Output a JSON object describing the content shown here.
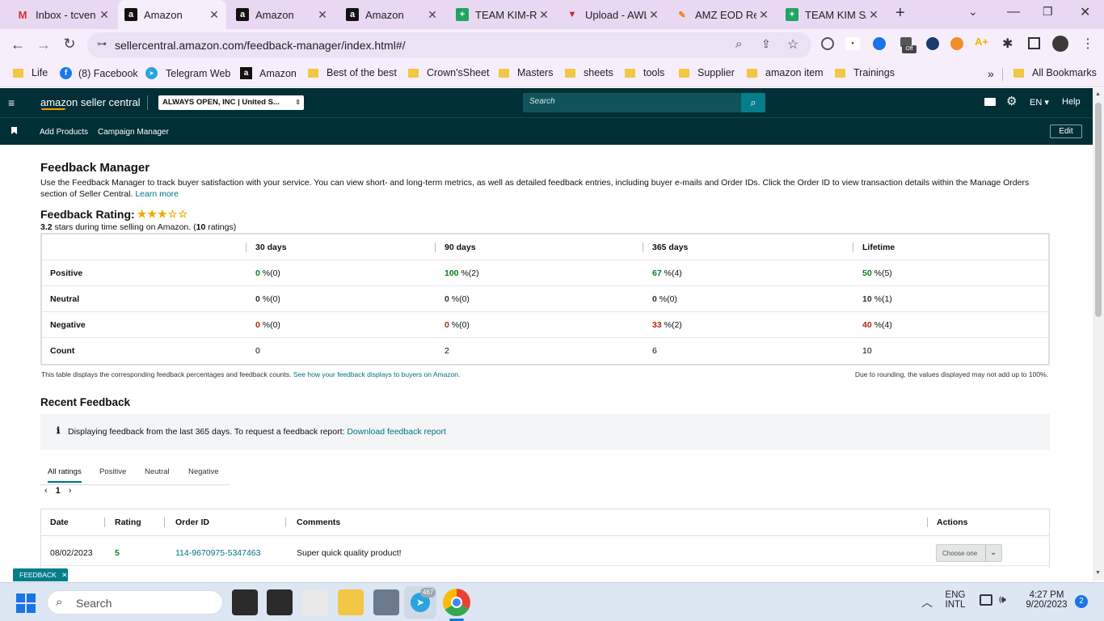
{
  "browser": {
    "tabs": [
      {
        "title": "Inbox - tcven",
        "icon": "gmail-icon"
      },
      {
        "title": "Amazon",
        "icon": "amazon-icon",
        "active": true
      },
      {
        "title": "Amazon",
        "icon": "amazon-icon"
      },
      {
        "title": "Amazon",
        "icon": "amazon-icon"
      },
      {
        "title": "TEAM KIM-RE",
        "icon": "sheets-icon"
      },
      {
        "title": "Upload - AWL",
        "icon": "upload-icon"
      },
      {
        "title": "AMZ EOD Rep",
        "icon": "pen-icon"
      },
      {
        "title": "TEAM KIM SA",
        "icon": "sheets-icon"
      }
    ],
    "url": "sellercentral.amazon.com/feedback-manager/index.html#/",
    "bookmarks": [
      {
        "label": "Life",
        "icon": "folder-icon"
      },
      {
        "label": "(8) Facebook",
        "icon": "facebook-icon"
      },
      {
        "label": "Telegram Web",
        "icon": "telegram-icon"
      },
      {
        "label": "Amazon",
        "icon": "amazon-icon"
      },
      {
        "label": "Best of the best",
        "icon": "folder-icon"
      },
      {
        "label": "Crown'sSheet",
        "icon": "folder-icon"
      },
      {
        "label": "Masters",
        "icon": "folder-icon"
      },
      {
        "label": "sheets",
        "icon": "folder-icon"
      },
      {
        "label": "tools",
        "icon": "folder-icon"
      },
      {
        "label": "Supplier",
        "icon": "folder-icon"
      },
      {
        "label": "amazon item",
        "icon": "folder-icon"
      },
      {
        "label": "Trainings",
        "icon": "folder-icon"
      }
    ],
    "all_bookmarks": "All Bookmarks"
  },
  "header": {
    "brand": "amazon seller central",
    "account": "ALWAYS OPEN, INC | United S...",
    "search_placeholder": "Search",
    "lang": "EN",
    "help": "Help",
    "subnav": [
      "Add Products",
      "Campaign Manager"
    ],
    "edit": "Edit"
  },
  "page": {
    "title": "Feedback Manager",
    "description": "Use the Feedback Manager to track buyer satisfaction with your service. You can view short- and long-term metrics, as well as detailed feedback entries, including buyer e-mails and Order IDs. Click the Order ID to view transaction details within the Manage Orders section of Seller Central.",
    "learn_more": "Learn more",
    "rating_label": "Feedback Rating:",
    "rating_stars": 3.2,
    "rating_summary_value": "3.2",
    "rating_summary_mid": " stars during time selling on Amazon. (",
    "rating_summary_count": "10",
    "rating_summary_end": " ratings)",
    "metrics_table": {
      "columns": [
        "30 days",
        "90 days",
        "365 days",
        "Lifetime"
      ],
      "rows": [
        {
          "label": "Positive",
          "values": [
            [
              "0",
              " %(0)"
            ],
            [
              "100",
              " %(2)"
            ],
            [
              "67",
              " %(4)"
            ],
            [
              "50",
              " %(5)"
            ]
          ]
        },
        {
          "label": "Neutral",
          "values": [
            [
              "0",
              " %(0)"
            ],
            [
              "0",
              " %(0)"
            ],
            [
              "0",
              " %(0)"
            ],
            [
              "10",
              " %(1)"
            ]
          ]
        },
        {
          "label": "Negative",
          "values": [
            [
              "0",
              " %(0)"
            ],
            [
              "0",
              " %(0)"
            ],
            [
              "33",
              " %(2)"
            ],
            [
              "40",
              " %(4)"
            ]
          ]
        },
        {
          "label": "Count",
          "values": [
            "0",
            "2",
            "6",
            "10"
          ]
        }
      ]
    },
    "note_left": "This table displays the corresponding feedback percentages and feedback counts.",
    "note_left_link": "See how your feedback displays to buyers on Amazon.",
    "note_right": "Due to rounding, the values displayed may not add up to 100%.",
    "recent_title": "Recent Feedback",
    "info_text": "Displaying feedback from the last 365 days. To request a feedback report:",
    "info_link": "Download feedback report",
    "filter_tabs": [
      "All ratings",
      "Positive",
      "Neutral",
      "Negative"
    ],
    "page_number": "1",
    "recent_columns": [
      "Date",
      "Rating",
      "Order ID",
      "Comments",
      "Actions"
    ],
    "recent_rows": [
      {
        "date": "08/02/2023",
        "rating": "5",
        "order_id": "114-9670975-5347463",
        "comment": "Super quick quality product!",
        "action": "Choose one"
      }
    ],
    "feedback_tab": "FEEDBACK"
  },
  "taskbar": {
    "search": "Search",
    "lang1": "ENG",
    "lang2": "INTL",
    "time": "4:27 PM",
    "date": "9/20/2023",
    "notif_count": "2",
    "telegram_badge": "467"
  }
}
